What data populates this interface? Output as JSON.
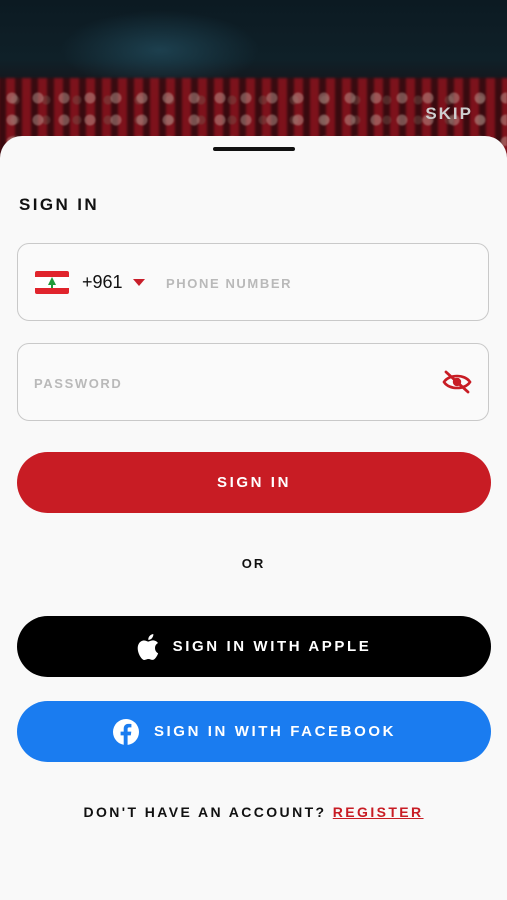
{
  "header": {
    "skip_label": "SKIP"
  },
  "signin": {
    "title": "SIGN IN",
    "country": {
      "dial_code": "+961",
      "flag": "lebanon-flag-icon"
    },
    "phone_placeholder": "PHONE NUMBER",
    "password_placeholder": "PASSWORD",
    "submit_label": "SIGN IN",
    "divider_label": "OR",
    "apple_label": "SIGN IN WITH APPLE",
    "facebook_label": "SIGN IN WITH FACEBOOK",
    "footer_prompt": "DON'T HAVE AN ACCOUNT?",
    "register_label": "REGISTER"
  },
  "colors": {
    "accent_red": "#c81c24",
    "apple_black": "#000000",
    "facebook_blue": "#1a7cf0",
    "sheet_bg": "#f9f9f9"
  },
  "icons": {
    "password_toggle": "eye-slash-icon",
    "apple": "apple-icon",
    "facebook": "facebook-icon"
  }
}
